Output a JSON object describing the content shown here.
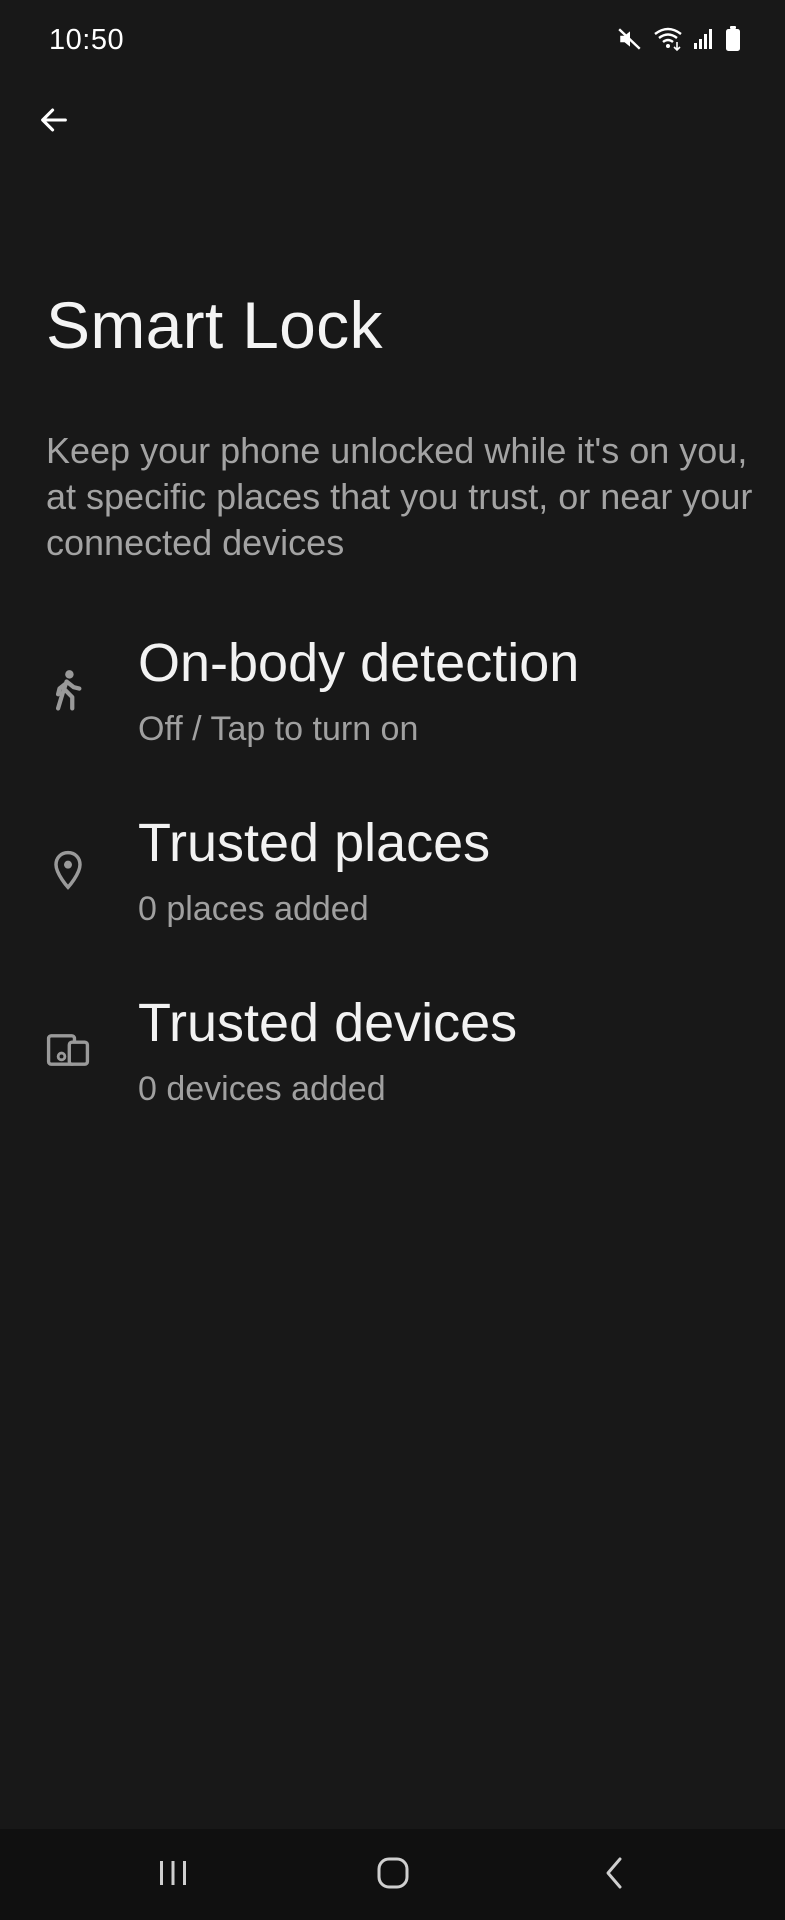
{
  "status_bar": {
    "time": "10:50",
    "icons": [
      "mute-icon",
      "wifi-icon",
      "signal-icon",
      "battery-icon"
    ]
  },
  "header": {
    "back_icon": "arrow-back-icon"
  },
  "page": {
    "title": "Smart Lock",
    "description": "Keep your phone unlocked while it's on you, at specific places that you trust, or near your connected devices"
  },
  "settings": [
    {
      "icon": "walking-person-icon",
      "title": "On-body detection",
      "subtitle": "Off / Tap to turn on"
    },
    {
      "icon": "location-pin-icon",
      "title": "Trusted places",
      "subtitle": "0 places added"
    },
    {
      "icon": "devices-icon",
      "title": "Trusted devices",
      "subtitle": "0 devices added"
    }
  ],
  "nav_bar": {
    "buttons": [
      "recent-apps-icon",
      "home-icon",
      "back-nav-icon"
    ]
  },
  "colors": {
    "background": "#181818",
    "title_text": "#f2f2f2",
    "secondary_text": "#a0a0a0",
    "icon_gray": "#9a9a9a",
    "nav_bar_background": "#101010"
  }
}
